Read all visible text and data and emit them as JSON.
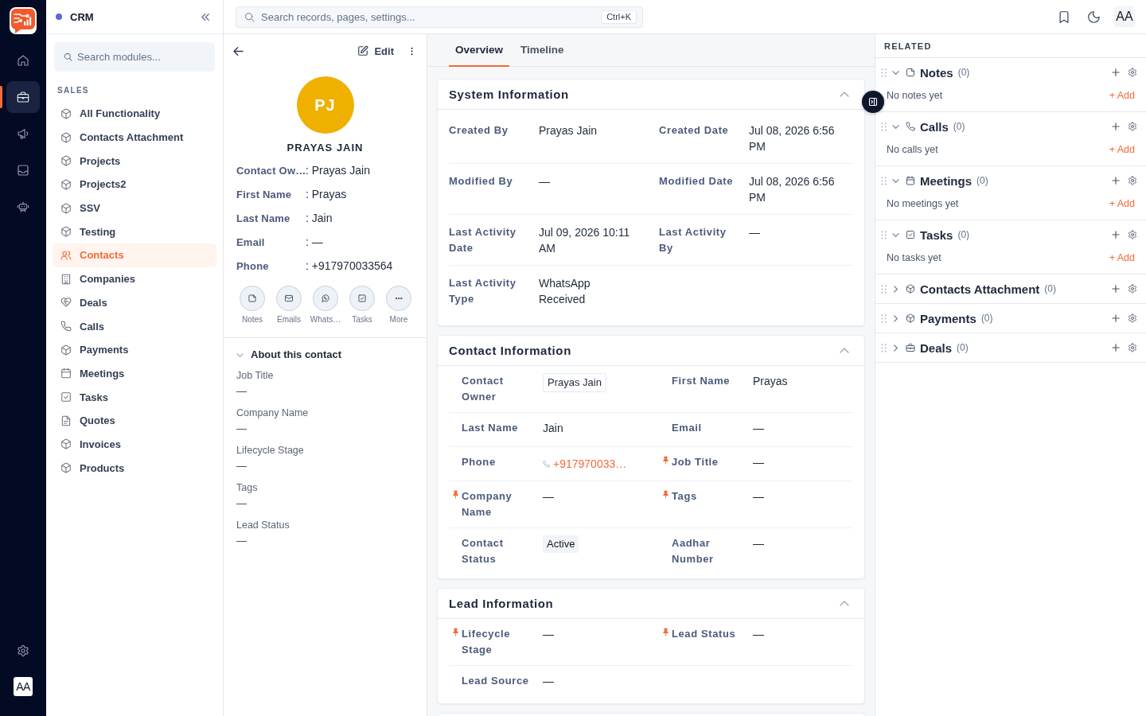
{
  "rail": {
    "items": [
      {
        "kind": "home",
        "selected": false
      },
      {
        "kind": "briefcase",
        "selected": true
      },
      {
        "kind": "megaphone",
        "selected": false
      },
      {
        "kind": "inbox",
        "selected": false
      },
      {
        "kind": "robot",
        "selected": false
      }
    ],
    "avatar": "AA"
  },
  "module_sidebar": {
    "title": "CRM",
    "search": {
      "placeholder": "Search modules..."
    },
    "section_label": "SALES",
    "items": [
      {
        "label": "All Functionality",
        "kind": "module",
        "selected": false
      },
      {
        "label": "Contacts Attachment",
        "kind": "module",
        "selected": false
      },
      {
        "label": "Projects",
        "kind": "module",
        "selected": false
      },
      {
        "label": "Projects2",
        "kind": "module",
        "selected": false
      },
      {
        "label": "SSV",
        "kind": "module",
        "selected": false
      },
      {
        "label": "Testing",
        "kind": "module",
        "selected": false
      },
      {
        "label": "Contacts",
        "kind": "contacts",
        "selected": true
      },
      {
        "label": "Companies",
        "kind": "building",
        "selected": false
      },
      {
        "label": "Deals",
        "kind": "handshake",
        "selected": false
      },
      {
        "label": "Calls",
        "kind": "phone",
        "selected": false
      },
      {
        "label": "Payments",
        "kind": "module",
        "selected": false
      },
      {
        "label": "Meetings",
        "kind": "calendar",
        "selected": false
      },
      {
        "label": "Tasks",
        "kind": "task",
        "selected": false
      },
      {
        "label": "Quotes",
        "kind": "document",
        "selected": false
      },
      {
        "label": "Invoices",
        "kind": "module",
        "selected": false
      },
      {
        "label": "Products",
        "kind": "module",
        "selected": false
      }
    ]
  },
  "topbar": {
    "search": {
      "placeholder": "Search records, pages, settings...",
      "shortcut": "Ctrl+K"
    },
    "avatar": "AA"
  },
  "contact_panel": {
    "edit_label": "Edit",
    "initials": "PJ",
    "name": "PRAYAS JAIN",
    "fields": [
      {
        "label": "Contact Ow…",
        "value": ": Prayas Jain"
      },
      {
        "label": "First Name",
        "value": ": Prayas"
      },
      {
        "label": "Last Name",
        "value": ": Jain"
      },
      {
        "label": "Email",
        "value": ": —"
      },
      {
        "label": "Phone",
        "value": ": +917970033564"
      }
    ],
    "actions": [
      {
        "label": "Notes",
        "kind": "note"
      },
      {
        "label": "Emails",
        "kind": "email"
      },
      {
        "label": "Whats…",
        "kind": "whatsapp"
      },
      {
        "label": "Tasks",
        "kind": "task"
      },
      {
        "label": "More",
        "kind": "more"
      }
    ],
    "about": {
      "title": "About this contact",
      "expanded": true,
      "fields": [
        {
          "label": "Job Title",
          "value": "—"
        },
        {
          "label": "Company Name",
          "value": "—"
        },
        {
          "label": "Lifecycle Stage",
          "value": "—"
        },
        {
          "label": "Tags",
          "value": "—"
        },
        {
          "label": "Lead Status",
          "value": "—"
        }
      ]
    }
  },
  "tabs": [
    {
      "label": "Overview",
      "selected": true
    },
    {
      "label": "Timeline",
      "selected": false
    }
  ],
  "sections": [
    {
      "title": "System Information",
      "expanded": true,
      "rows": [
        [
          {
            "label": "Created By",
            "value": "Prayas Jain",
            "kind": "text"
          },
          {
            "label": "Created Date",
            "value": "Jul 08, 2026 6:56 PM",
            "kind": "text"
          }
        ],
        [
          {
            "label": "Modified By",
            "value": "—",
            "kind": "text"
          },
          {
            "label": "Modified Date",
            "value": "Jul 08, 2026 6:56 PM",
            "kind": "text"
          }
        ],
        [
          {
            "label": "Last Activity Date",
            "value": "Jul 09, 2026 10:11 AM",
            "kind": "text"
          },
          {
            "label": "Last Activity By",
            "value": "—",
            "kind": "text"
          }
        ],
        [
          {
            "label": "Last Activity Type",
            "value": "WhatsApp Received",
            "kind": "text"
          }
        ]
      ]
    },
    {
      "title": "Contact Information",
      "expanded": true,
      "rows": [
        [
          {
            "label": "Contact Owner",
            "value": "Prayas Jain",
            "kind": "chip",
            "pinned": false
          },
          {
            "label": "First Name",
            "value": "Prayas",
            "kind": "text",
            "pinned": false
          }
        ],
        [
          {
            "label": "Last Name",
            "value": "Jain",
            "kind": "text",
            "pinned": false
          },
          {
            "label": "Email",
            "value": "—",
            "kind": "text",
            "pinned": false
          }
        ],
        [
          {
            "label": "Phone",
            "value": "+917970033…",
            "kind": "phone",
            "pinned": false
          },
          {
            "label": "Job Title",
            "value": "—",
            "kind": "text",
            "pinned": true
          }
        ],
        [
          {
            "label": "Company Name",
            "value": "—",
            "kind": "text",
            "pinned": true
          },
          {
            "label": "Tags",
            "value": "—",
            "kind": "text",
            "pinned": true
          }
        ],
        [
          {
            "label": "Contact Status",
            "value": "Active",
            "kind": "badge",
            "pinned": false
          },
          {
            "label": "Aadhar Number",
            "value": "—",
            "kind": "text",
            "pinned": false
          }
        ]
      ]
    },
    {
      "title": "Lead Information",
      "expanded": true,
      "rows": [
        [
          {
            "label": "Lifecycle Stage",
            "value": "—",
            "kind": "text",
            "pinned": true
          },
          {
            "label": "Lead Status",
            "value": "—",
            "kind": "text",
            "pinned": true
          }
        ],
        [
          {
            "label": "Lead Source",
            "value": "—",
            "kind": "text",
            "pinned": false
          }
        ]
      ]
    }
  ],
  "related": {
    "title": "RELATED",
    "groups": [
      {
        "title": "Notes",
        "count": "(0)",
        "kind": "note",
        "expanded": true,
        "empty_text": "No notes yet",
        "add_label": "+ Add"
      },
      {
        "title": "Calls",
        "count": "(0)",
        "kind": "phone",
        "expanded": true,
        "empty_text": "No calls yet",
        "add_label": "+ Add"
      },
      {
        "title": "Meetings",
        "count": "(0)",
        "kind": "calendar",
        "expanded": true,
        "empty_text": "No meetings yet",
        "add_label": "+ Add"
      },
      {
        "title": "Tasks",
        "count": "(0)",
        "kind": "task",
        "expanded": true,
        "empty_text": "No tasks yet",
        "add_label": "+ Add"
      },
      {
        "title": "Contacts Attachment",
        "count": "(0)",
        "kind": "module",
        "expanded": false
      },
      {
        "title": "Payments",
        "count": "(0)",
        "kind": "module",
        "expanded": false
      },
      {
        "title": "Deals",
        "count": "(0)",
        "kind": "briefcase",
        "expanded": false
      }
    ]
  }
}
